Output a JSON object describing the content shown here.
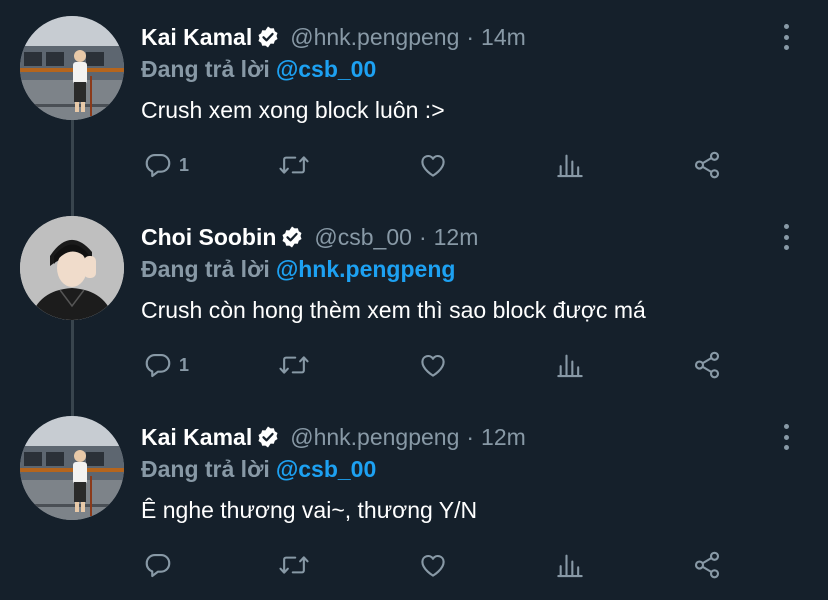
{
  "tweets": [
    {
      "name": "Kai Kamal",
      "handle": "@hnk.pengpeng",
      "time": "14m",
      "reply_prefix": "Đang trả lời",
      "reply_to": "@csb_00",
      "text": "Crush xem xong block luôn :>",
      "reply_count": "1"
    },
    {
      "name": "Choi Soobin",
      "handle": "@csb_00",
      "time": "12m",
      "reply_prefix": "Đang trả lời",
      "reply_to": "@hnk.pengpeng",
      "text": "Crush còn hong thèm xem thì sao block được má",
      "reply_count": "1"
    },
    {
      "name": "Kai Kamal",
      "handle": "@hnk.pengpeng",
      "time": "12m",
      "reply_prefix": "Đang trả lời",
      "reply_to": "@csb_00",
      "text": "Ê nghe thương vai~, thương Y/N",
      "reply_count": ""
    }
  ],
  "separator": "·",
  "icons": {
    "verified": "verified-badge-icon",
    "more": "more-options-icon",
    "reply": "reply-icon",
    "retweet": "retweet-icon",
    "like": "like-heart-icon",
    "analytics": "analytics-icon",
    "share": "share-icon"
  },
  "colors": {
    "background": "#15202b",
    "secondary_text": "#8899a6",
    "accent": "#1da1f2",
    "thread_line": "#38444d"
  }
}
